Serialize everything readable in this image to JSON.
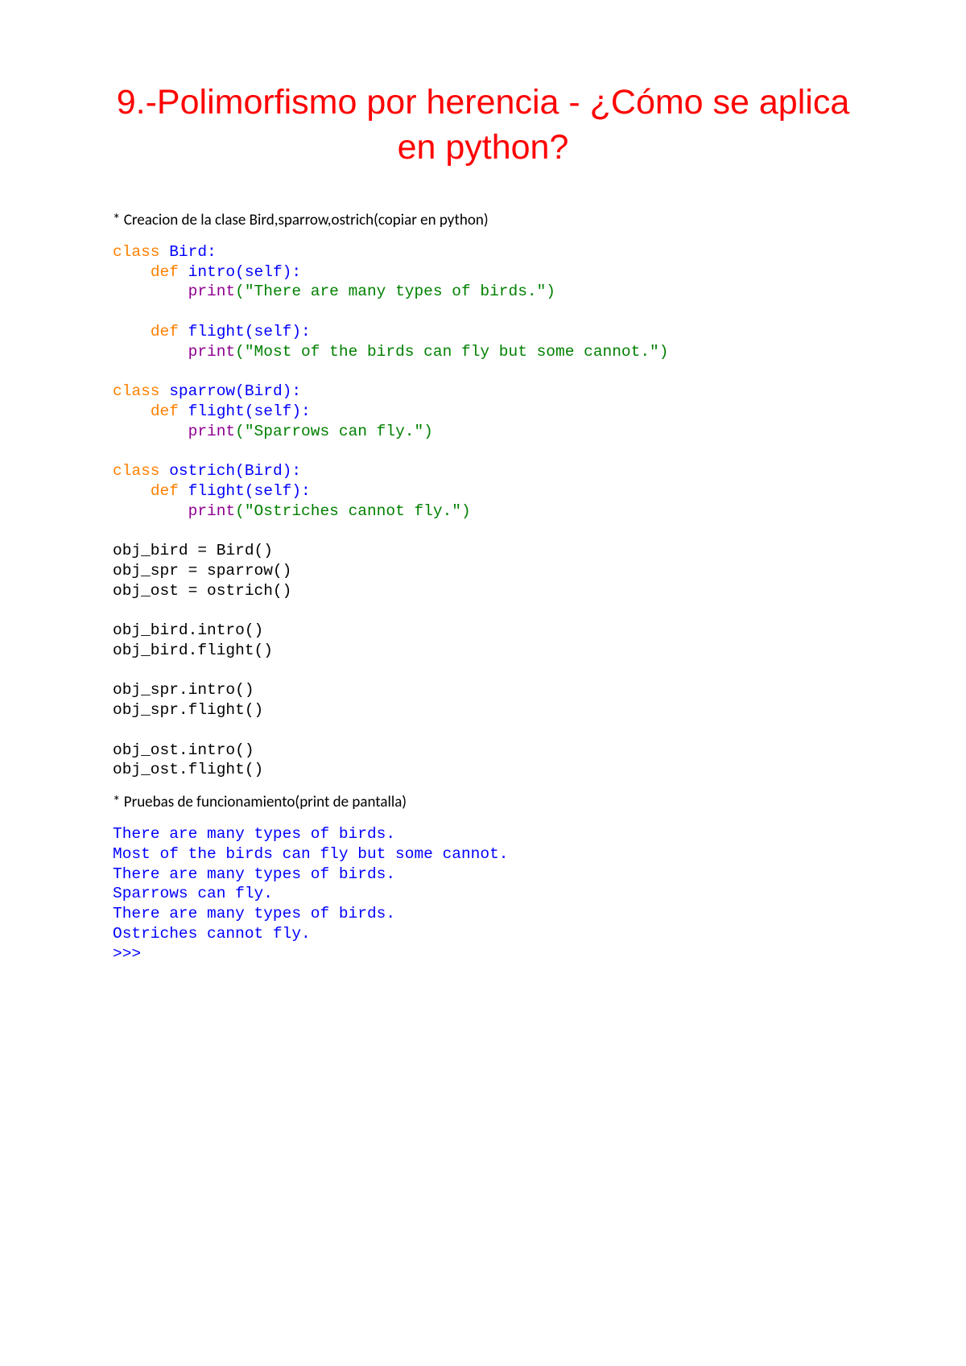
{
  "title": "9.-Polimorfismo por herencia - ¿Cómo se aplica en python?",
  "intro1": "* Creacion de la clase Bird,sparrow,ostrich(copiar en python)",
  "intro2": "* Pruebas de funcionamiento(print de pantalla)",
  "code": {
    "kw_class": "class",
    "kw_def": "def",
    "kw_print": "print",
    "line1_name": " Bird:",
    "line2_sig": " intro(self):",
    "line3_str": "(\"There are many types of birds.\")",
    "line4_sig": " flight(self):",
    "line5_str": "(\"Most of the birds can fly but some cannot.\")",
    "line6_name": " sparrow(Bird):",
    "line7_sig": " flight(self):",
    "line8_str": "(\"Sparrows can fly.\")",
    "line9_name": " ostrich(Bird):",
    "line10_sig": " flight(self):",
    "line11_str": "(\"Ostriches cannot fly.\")",
    "inst1": "obj_bird = Bird()",
    "inst2": "obj_spr = sparrow()",
    "inst3": "obj_ost = ostrich()",
    "call1": "obj_bird.intro()",
    "call2": "obj_bird.flight()",
    "call3": "obj_spr.intro()",
    "call4": "obj_spr.flight()",
    "call5": "obj_ost.intro()",
    "call6": "obj_ost.flight()"
  },
  "output": {
    "o1": "There are many types of birds.",
    "o2": "Most of the birds can fly but some cannot.",
    "o3": "There are many types of birds.",
    "o4": "Sparrows can fly.",
    "o5": "There are many types of birds.",
    "o6": "Ostriches cannot fly.",
    "prompt": ">>>"
  }
}
